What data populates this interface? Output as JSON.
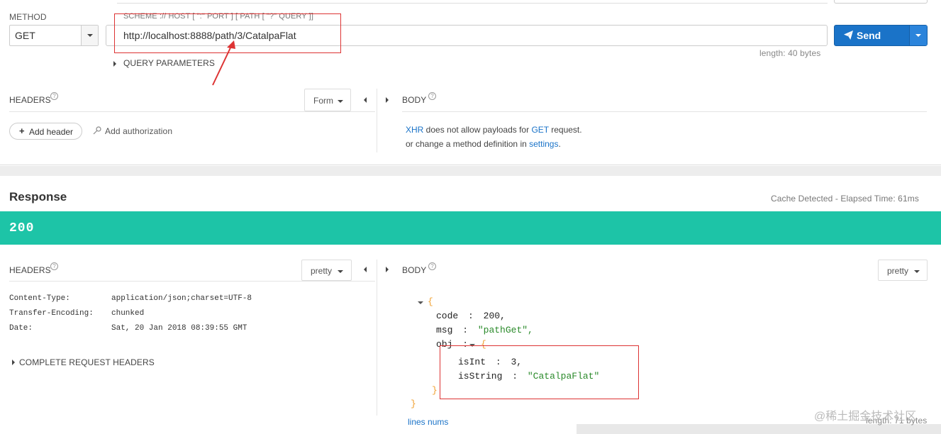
{
  "request": {
    "method_label": "METHOD",
    "method_value": "GET",
    "url_hint": "SCHEME :// HOST [ \":\" PORT ] [ PATH [ \"?\" QUERY ]]",
    "url_value": "http://localhost:8888/path/3/CatalpaFlat",
    "send_label": "Send",
    "length_text": "length: 40 bytes",
    "query_params_label": "QUERY PARAMETERS",
    "headers_label": "HEADERS",
    "form_label": "Form",
    "add_header_label": "Add header",
    "add_auth_label": "Add authorization",
    "body_label": "BODY",
    "body_msg_xhr": "XHR",
    "body_msg_1": " does not allow payloads for ",
    "body_msg_get": "GET",
    "body_msg_2": " request.",
    "body_msg_3": "or change a method definition in ",
    "body_msg_settings": "settings",
    "body_msg_end": "."
  },
  "response": {
    "title": "Response",
    "cache_text": "Cache Detected - Elapsed Time: 61ms",
    "status_code": "200",
    "headers_label": "HEADERS",
    "headers_format": "pretty",
    "headers": [
      {
        "name": "Content-Type:",
        "value": "application/json;charset=UTF-8"
      },
      {
        "name": "Transfer-Encoding:",
        "value": "chunked"
      },
      {
        "name": "Date:",
        "value": "Sat, 20 Jan 2018 08:39:55 GMT"
      }
    ],
    "complete_headers_label": "COMPLETE REQUEST HEADERS",
    "body_label": "BODY",
    "body_format": "pretty",
    "json": {
      "open_brace": "{",
      "close_brace": "}",
      "code_key": "code",
      "code_value": "200,",
      "msg_key": "msg",
      "msg_value": "\"pathGet\",",
      "obj_key": "obj",
      "isInt_key": "isInt",
      "isInt_value": "3,",
      "isString_key": "isString",
      "isString_value": "\"CatalpaFlat\"",
      "colon": ":"
    },
    "lines_nums_label": "lines nums",
    "length_text": "length: 71 bytes"
  },
  "watermark": "@稀土掘金技术社区",
  "colors": {
    "status_green": "#1dc4a7",
    "send_blue": "#1a73c8",
    "annotation_red": "#d33333"
  }
}
